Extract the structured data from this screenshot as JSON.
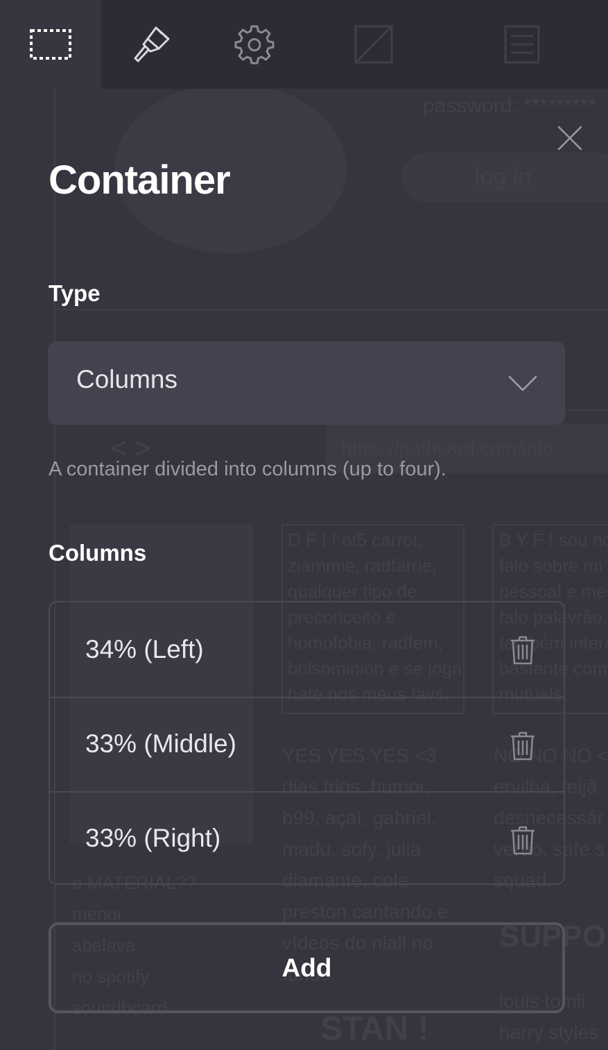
{
  "toolbar": {
    "tabs": [
      {
        "icon": "selection-icon",
        "active": true
      },
      {
        "icon": "brush-icon",
        "active": false
      },
      {
        "icon": "gear-icon",
        "active": false
      },
      {
        "icon": "image-icon",
        "active": false
      },
      {
        "icon": "list-icon",
        "active": false
      }
    ]
  },
  "panel": {
    "title": "Container",
    "close_icon": "close-icon",
    "type_label": "Type",
    "type_value": "Columns",
    "type_description": "A container divided into columns (up to four).",
    "columns_label": "Columns",
    "columns": [
      {
        "label": "34% (Left)",
        "delete_icon": "trash-icon"
      },
      {
        "label": "33% (Middle)",
        "delete_icon": "trash-icon"
      },
      {
        "label": "33% (Right)",
        "delete_icon": "trash-icon"
      }
    ],
    "add_label": "Add"
  },
  "background": {
    "password": "password: *********",
    "login": "log in",
    "url": "https://pathcard.com/info",
    "nav": "< >",
    "para1": "D F I ! ot5 carrot,\nziammie, radfarrie,\nqualquer tipo de\npreconceito e\nhomofobia, radfem,\nbolsominion e se joga\nhate nos meus favs.",
    "para2": "B Y F ! sou no\nfalo sobre mi\npessoal e mes\nfalo palavrão,\ntambém intera\nbastante com\nmutuals.",
    "para3": "YES YES YES <3\ndias frios, humor,\nb99, açaí, gabriel,\nmadu, sofy, julia\ndiamante, cole\npreston cantando e\nvídeos do niall no\nfundo.",
    "para4": "NO NO NO <\nervilha, feijã\ndesnecessár\nverão, safe s\nsquad.",
    "para5": "o MATERIAL??\nmenor\nabelava\nno spotify\nsoundboard",
    "support": "SUPPO",
    "stan": "STAN !",
    "harry": "louis tomli\nharry styles"
  },
  "colors": {
    "background": "#35353f",
    "toolbar": "#2c2c35",
    "select": "#43434f",
    "border": "#4a4a55",
    "muted_text": "#9a9aa4"
  }
}
